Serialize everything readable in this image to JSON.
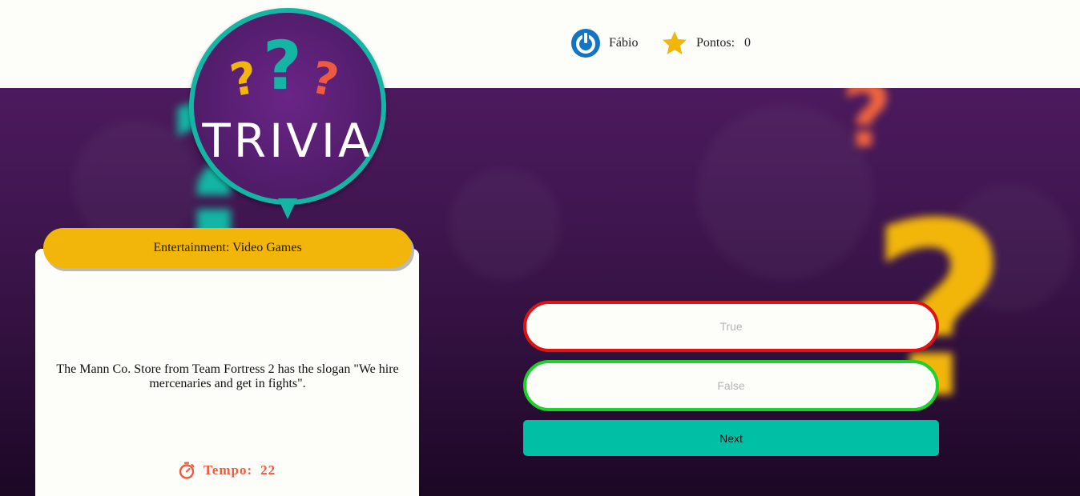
{
  "header": {
    "user_name": "Fábio",
    "score_label": "Pontos:",
    "score_value": "0",
    "user_icon": "power-icon",
    "score_icon": "star-icon"
  },
  "logo": {
    "title": "TRIVIA",
    "marks": [
      "?",
      "?",
      "?"
    ]
  },
  "question_card": {
    "category": "Entertainment: Video Games",
    "question": "The Mann Co. Store from Team Fortress 2 has the slogan \"We hire mercenaries and get in fights\".",
    "timer_label": "Tempo:",
    "timer_value": "22",
    "timer_icon": "stopwatch-icon"
  },
  "answers": {
    "true_label": "True",
    "false_label": "False"
  },
  "next_label": "Next",
  "colors": {
    "accent_teal": "#00bfa5",
    "category_yellow": "#f2b60b",
    "wrong_red": "#e01313",
    "correct_green": "#1ed02a",
    "timer_orange": "#ee5a3f",
    "background_purple": "#4c1a5e"
  }
}
